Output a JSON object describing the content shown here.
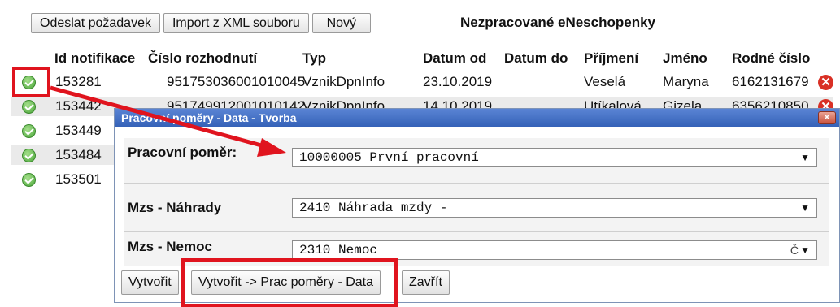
{
  "toolbar": {
    "send_label": "Odeslat požadavek",
    "import_label": "Import z XML souboru",
    "new_label": "Nový"
  },
  "list_title": "Nezpracované eNeschopenky",
  "table": {
    "headers": [
      "Id notifikace",
      "Číslo rozhodnutí",
      "Typ",
      "Datum od",
      "Datum do",
      "Příjmení",
      "Jméno",
      "Rodné číslo"
    ],
    "rows": [
      {
        "id": "153281",
        "cislo": "951753036001010045",
        "typ": "VznikDpnInfo",
        "od": "23.10.2019",
        "do": "",
        "prijmeni": "Veselá",
        "jmeno": "Maryna",
        "rc": "6162131679"
      },
      {
        "id": "153442",
        "cislo": "951749912001010142",
        "typ": "VznikDpnInfo",
        "od": "14.10.2019",
        "do": "",
        "prijmeni": "Utíkalová",
        "jmeno": "Gizela",
        "rc": "6356210850"
      },
      {
        "id": "153449"
      },
      {
        "id": "153484"
      },
      {
        "id": "153501"
      }
    ]
  },
  "dialog": {
    "title": "Pracovní poměry - Data - Tvorba",
    "close_icon": "close-icon",
    "fields": [
      {
        "label": "Pracovní poměr:",
        "value": "10000005 První pracovní",
        "extra": ""
      },
      {
        "label": "Mzs - Náhrady",
        "value": "2410 Náhrada mzdy -",
        "extra": ""
      },
      {
        "label": "Mzs - Nemoc",
        "value": "2310 Nemoc",
        "extra": "Č"
      }
    ],
    "buttons": {
      "create": "Vytvořit",
      "create_data": "Vytvořit -> Prac poměry - Data",
      "close": "Zavřít"
    }
  },
  "colors": {
    "highlight": "#e0141e",
    "dialog_title_bg": "#3562b8",
    "ok_icon": "#4aa63a",
    "delete_icon": "#d93025"
  },
  "icons": {
    "row_status": "check-circle-icon",
    "row_delete": "delete-x-icon",
    "dropdown": "chevron-down-icon"
  }
}
